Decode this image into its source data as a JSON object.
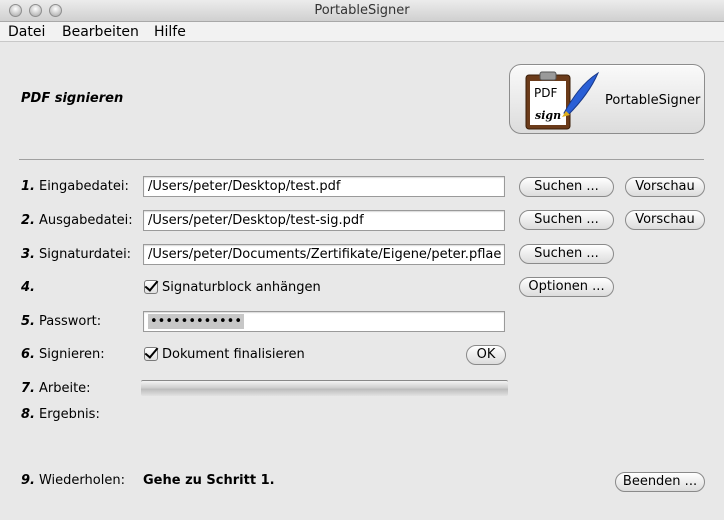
{
  "window": {
    "title": "PortableSigner"
  },
  "menu": [
    "Datei",
    "Bearbeiten",
    "Hilfe"
  ],
  "heading": "PDF signieren",
  "logo": {
    "label": "PortableSigner",
    "pdf_text": "PDF",
    "sign_text": "sign"
  },
  "rows": {
    "input": {
      "num": "1.",
      "label": "Eingabedatei:",
      "value": "/Users/peter/Desktop/test.pdf",
      "search": "Suchen ...",
      "preview": "Vorschau"
    },
    "output": {
      "num": "2.",
      "label": "Ausgabedatei:",
      "value": "/Users/peter/Desktop/test-sig.pdf",
      "search": "Suchen ...",
      "preview": "Vorschau"
    },
    "signature": {
      "num": "3.",
      "label": "Signaturdatei:",
      "value": "/Users/peter/Documents/Zertifikate/Eigene/peter.pflae",
      "search": "Suchen ..."
    },
    "block": {
      "num": "4.",
      "checkbox_label": "Signaturblock anhängen",
      "checked": true,
      "options": "Optionen ..."
    },
    "password": {
      "num": "5.",
      "label": "Passwort:",
      "masked": "••••••••••••"
    },
    "sign": {
      "num": "6.",
      "label": "Signieren:",
      "checkbox_label": "Dokument finalisieren",
      "checked": true,
      "ok": "OK"
    },
    "work": {
      "num": "7.",
      "label": "Arbeite:",
      "progress": 0
    },
    "result": {
      "num": "8.",
      "label": "Ergebnis:"
    },
    "repeat": {
      "num": "9.",
      "label": "Wiederholen:",
      "text": "Gehe zu Schritt 1.",
      "quit": "Beenden ..."
    }
  }
}
